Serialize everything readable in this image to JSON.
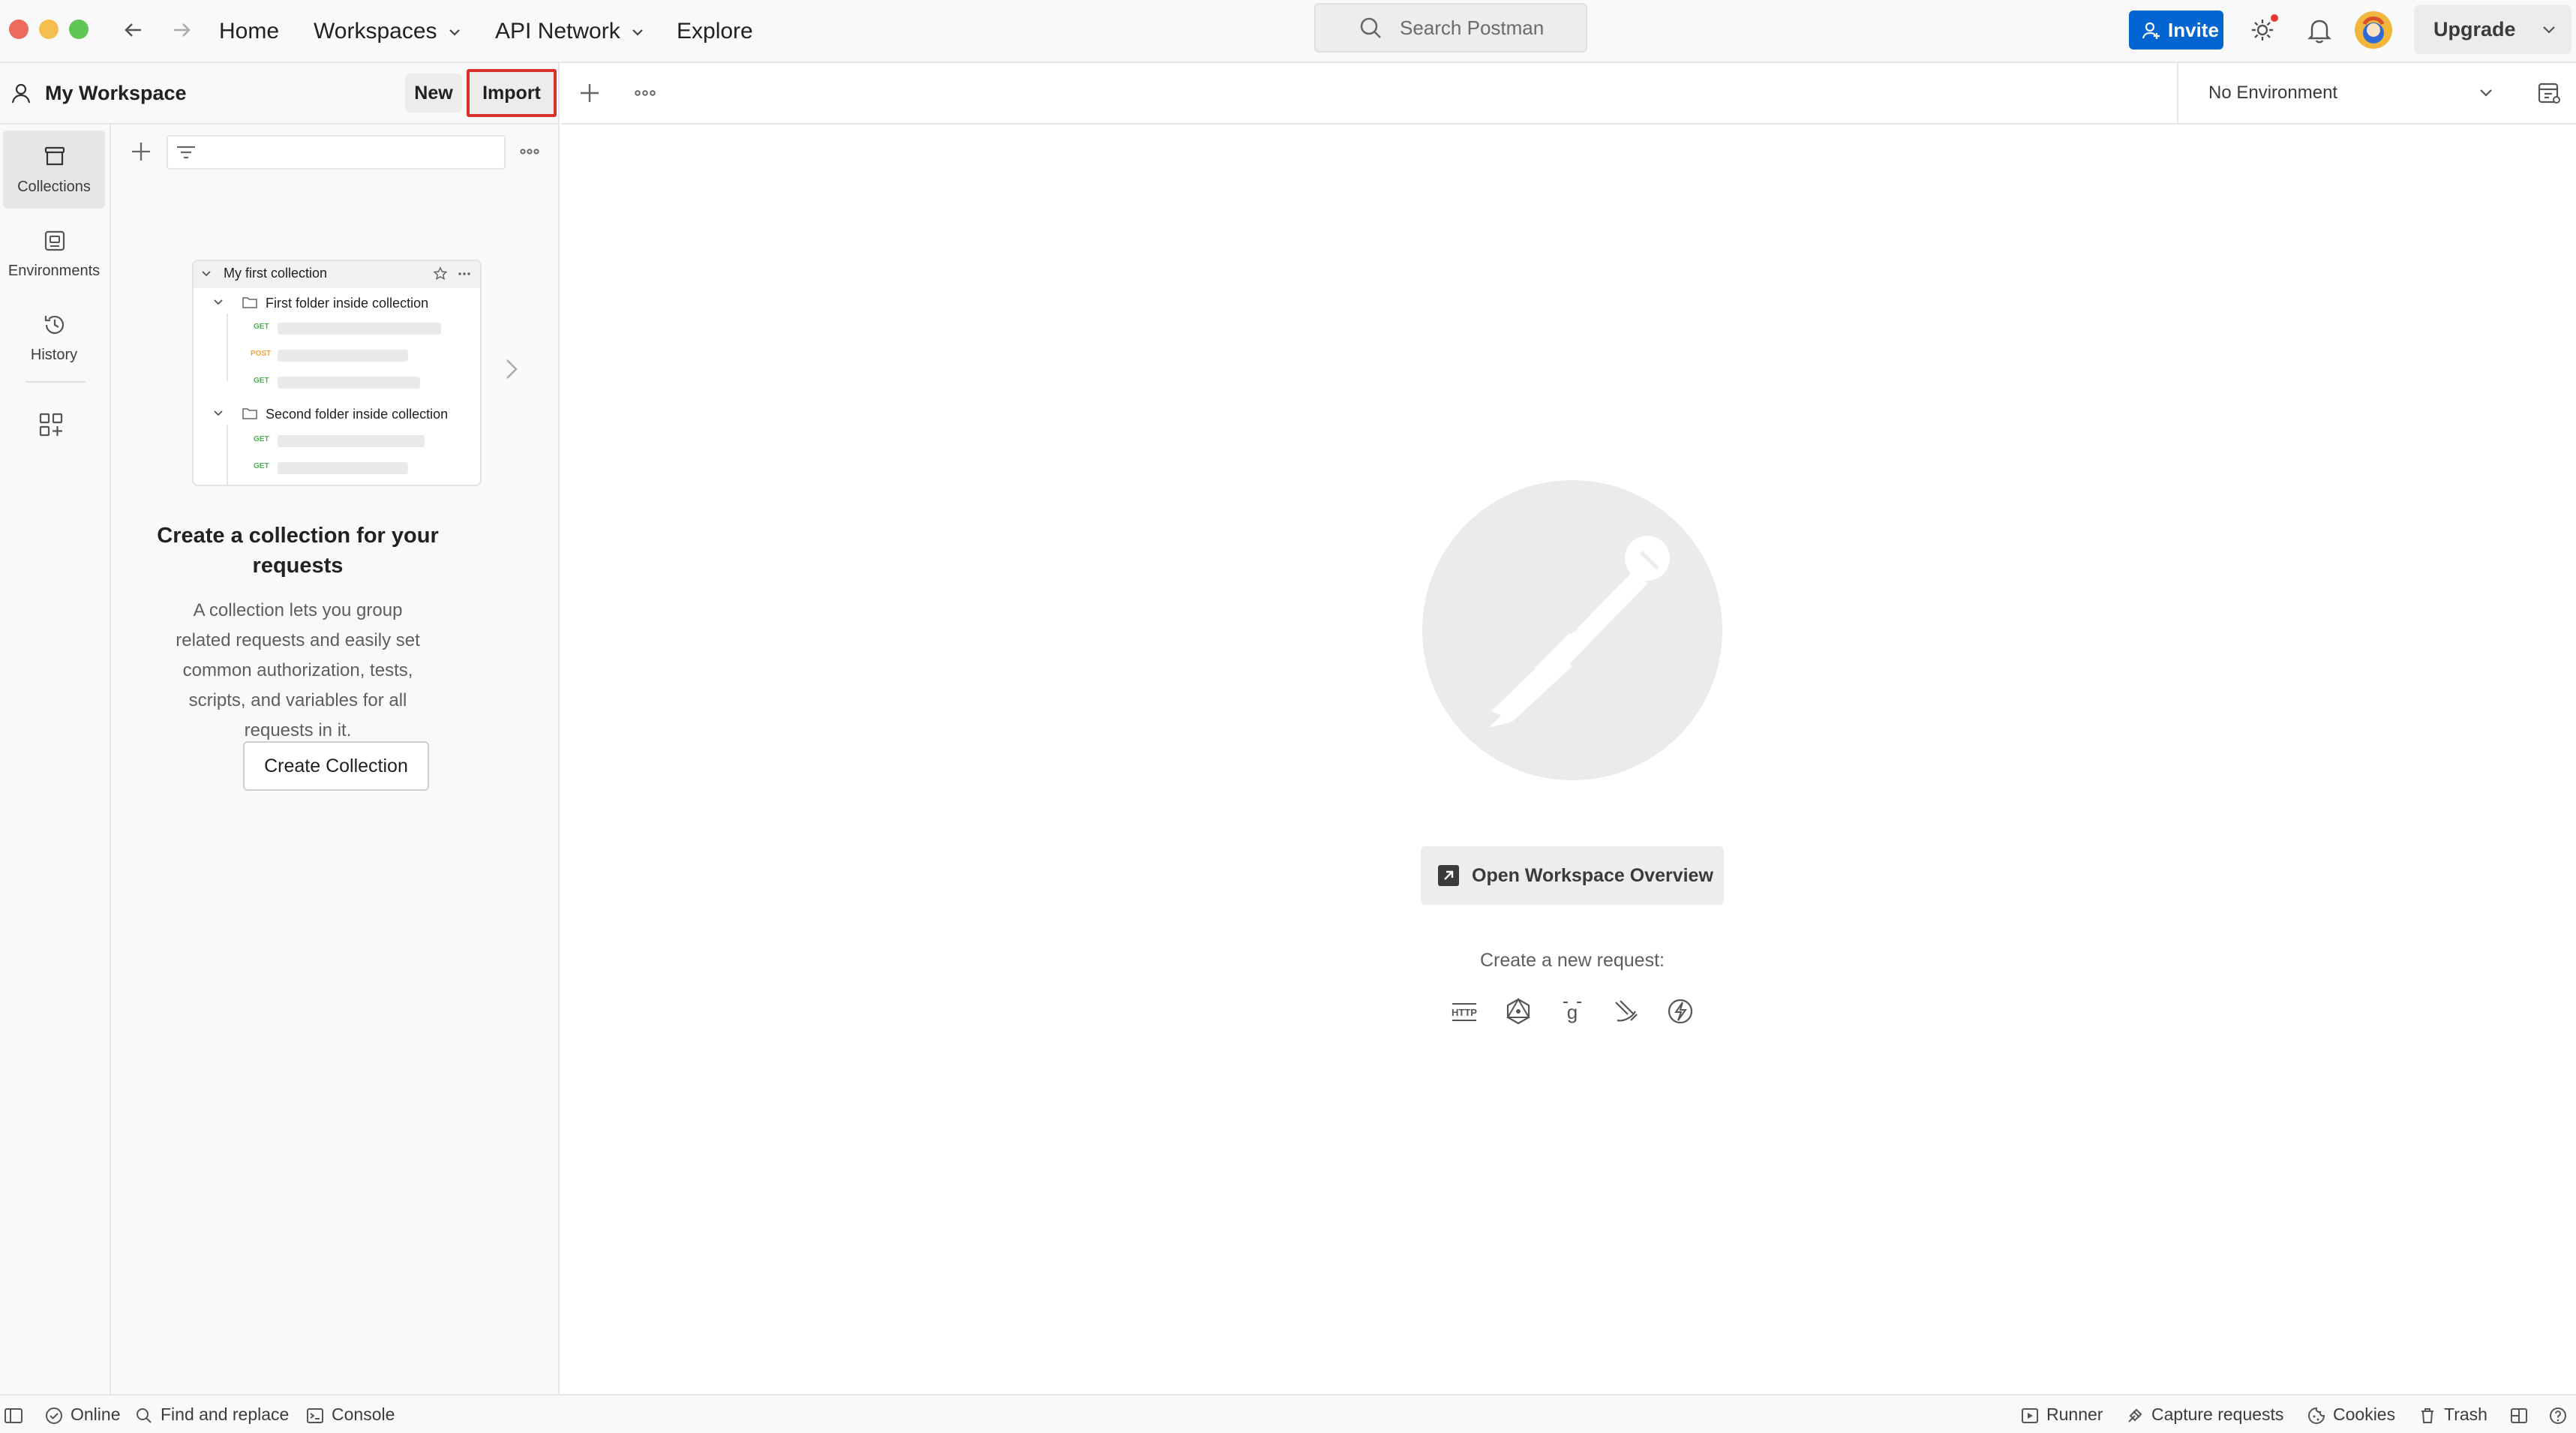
{
  "nav": {
    "home": "Home",
    "workspaces": "Workspaces",
    "api_network": "API Network",
    "explore": "Explore",
    "search_placeholder": "Search Postman",
    "invite": "Invite",
    "upgrade": "Upgrade"
  },
  "workspace": {
    "title": "My Workspace",
    "new_label": "New",
    "import_label": "Import"
  },
  "environment": {
    "selected": "No Environment"
  },
  "rail": {
    "collections": "Collections",
    "environments": "Environments",
    "history": "History"
  },
  "illustration": {
    "collection_name": "My first collection",
    "folder1": "First folder inside collection",
    "folder2": "Second folder inside collection",
    "methods": [
      "GET",
      "POST",
      "GET",
      "GET",
      "GET"
    ]
  },
  "empty_state": {
    "title": "Create a collection for your requests",
    "description": "A collection lets you group related requests and easily set common authorization, tests, scripts, and variables for all requests in it.",
    "button": "Create Collection"
  },
  "main": {
    "overview_button": "Open Workspace Overview",
    "new_request_label": "Create a new request:",
    "request_types": [
      "http-icon",
      "graphql-icon",
      "grpc-icon",
      "websocket-icon",
      "socketio-icon"
    ]
  },
  "statusbar": {
    "online": "Online",
    "find_replace": "Find and replace",
    "console": "Console",
    "runner": "Runner",
    "capture": "Capture requests",
    "cookies": "Cookies",
    "trash": "Trash"
  },
  "colors": {
    "invite_bg": "#0265d2",
    "import_highlight": "#d9312a",
    "get_method": "#4caf50",
    "post_method": "#f2a33a",
    "notification_dot": "#e53935"
  }
}
